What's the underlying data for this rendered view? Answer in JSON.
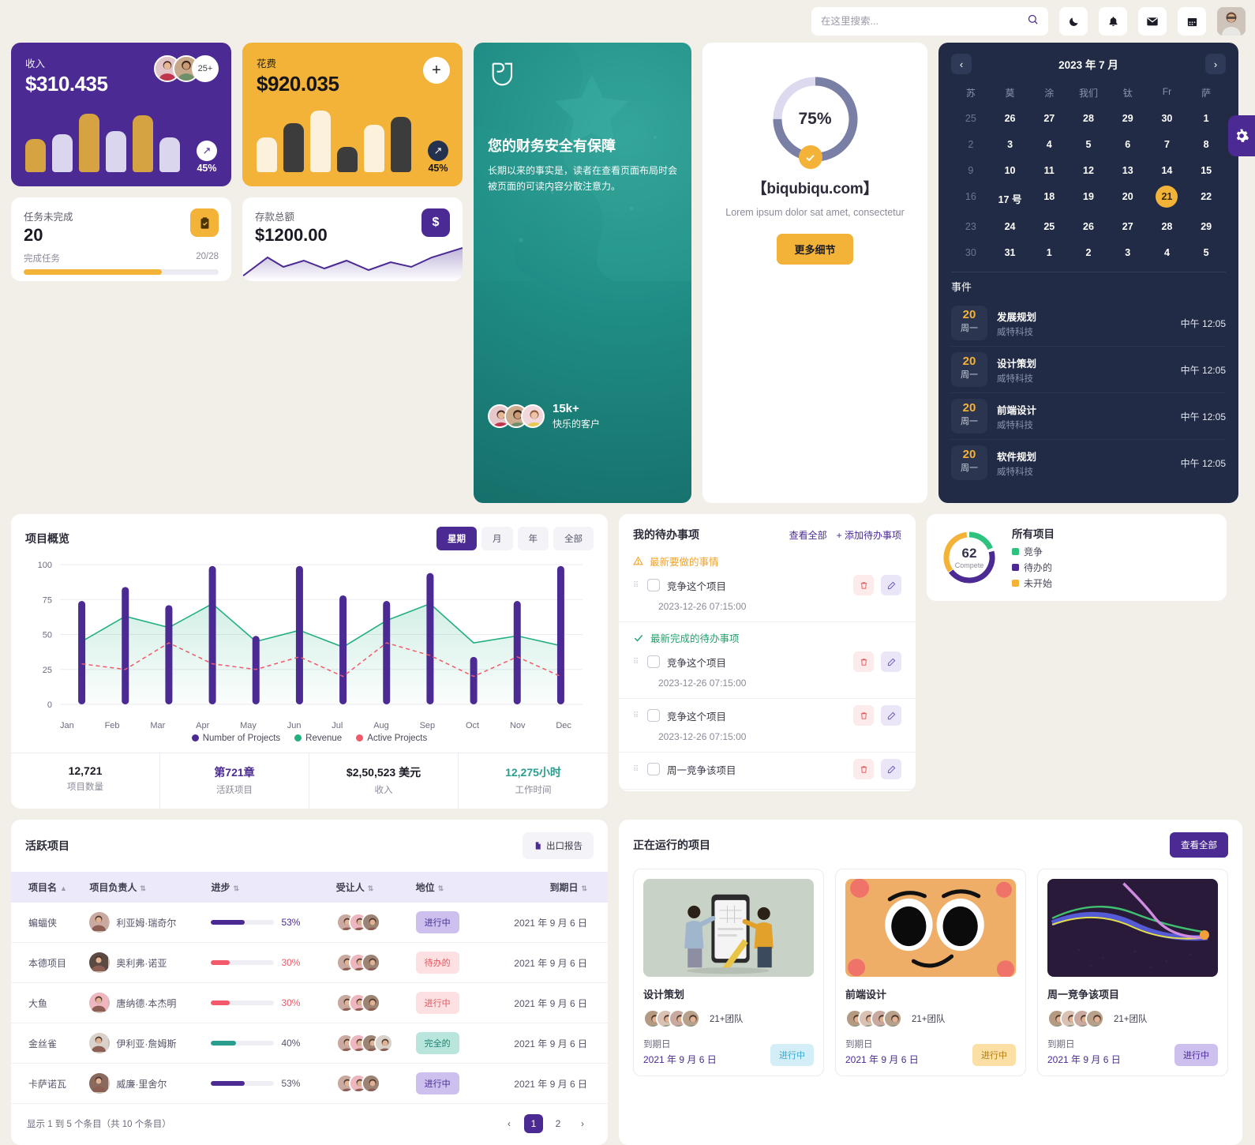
{
  "header": {
    "search_placeholder": "在这里搜索...",
    "icons": [
      "moon-icon",
      "bell-icon",
      "mail-icon",
      "calendar-icon"
    ]
  },
  "income_card": {
    "label": "收入",
    "value": "$310.435",
    "more": "25+",
    "pct": "45%"
  },
  "expense_card": {
    "label": "花费",
    "value": "$920.035",
    "pct": "45%"
  },
  "tasks_card": {
    "label": "任务未完成",
    "value": "20",
    "sub": "完成任务",
    "ratio": "20/28",
    "progress": 71
  },
  "savings_card": {
    "label": "存款总额",
    "value": "$1200.00",
    "currency": "$"
  },
  "promo": {
    "title": "您的财务安全有保障",
    "body": "长期以来的事实是，读者在查看页面布局时会被页面的可读内容分散注意力。",
    "count": "15k+",
    "count_label": "快乐的客户"
  },
  "progress_card": {
    "percent": "75%",
    "site": "【biqubiqu.com】",
    "lorem": "Lorem ipsum dolor sat amet, consectetur",
    "button": "更多细节"
  },
  "calendar": {
    "title": "2023 年 7 月",
    "prev": "‹",
    "next": "›",
    "dow": [
      "苏",
      "莫",
      "涂",
      "我们",
      "钛",
      "Fr",
      "萨"
    ],
    "weeks": [
      [
        {
          "d": "25",
          "m": 1
        },
        {
          "d": "26"
        },
        {
          "d": "27"
        },
        {
          "d": "28"
        },
        {
          "d": "29"
        },
        {
          "d": "30"
        },
        {
          "d": "1"
        }
      ],
      [
        {
          "d": "2",
          "m": 1
        },
        {
          "d": "3"
        },
        {
          "d": "4"
        },
        {
          "d": "5"
        },
        {
          "d": "6"
        },
        {
          "d": "7"
        },
        {
          "d": "8"
        }
      ],
      [
        {
          "d": "9",
          "m": 1
        },
        {
          "d": "10"
        },
        {
          "d": "11"
        },
        {
          "d": "12"
        },
        {
          "d": "13"
        },
        {
          "d": "14"
        },
        {
          "d": "15"
        }
      ],
      [
        {
          "d": "16",
          "m": 1
        },
        {
          "d": "17 号"
        },
        {
          "d": "18"
        },
        {
          "d": "19"
        },
        {
          "d": "20"
        },
        {
          "d": "21",
          "sel": 1
        },
        {
          "d": "22"
        }
      ],
      [
        {
          "d": "23",
          "m": 1
        },
        {
          "d": "24"
        },
        {
          "d": "25"
        },
        {
          "d": "26"
        },
        {
          "d": "27"
        },
        {
          "d": "28"
        },
        {
          "d": "29"
        }
      ],
      [
        {
          "d": "30",
          "m": 1
        },
        {
          "d": "31"
        },
        {
          "d": "1"
        },
        {
          "d": "2"
        },
        {
          "d": "3"
        },
        {
          "d": "4"
        },
        {
          "d": "5"
        }
      ]
    ],
    "events_title": "事件",
    "events": [
      {
        "day": "20",
        "weekday": "周一",
        "name": "发展规划",
        "org": "威特科技",
        "time": "中午 12:05"
      },
      {
        "day": "20",
        "weekday": "周一",
        "name": "设计策划",
        "org": "威特科技",
        "time": "中午 12:05"
      },
      {
        "day": "20",
        "weekday": "周一",
        "name": "前端设计",
        "org": "威特科技",
        "time": "中午 12:05"
      },
      {
        "day": "20",
        "weekday": "周一",
        "name": "软件规划",
        "org": "威特科技",
        "time": "中午 12:05"
      }
    ]
  },
  "overview": {
    "title": "项目概览",
    "tabs": [
      {
        "label": "星期",
        "active": true
      },
      {
        "label": "月",
        "active": false
      },
      {
        "label": "年",
        "active": false
      },
      {
        "label": "全部",
        "active": false
      }
    ],
    "stats": [
      {
        "n": "12,721",
        "l": "项目数量",
        "c": "#1a1a24"
      },
      {
        "n": "第721章",
        "l": "活跃项目",
        "c": "#4b2a94"
      },
      {
        "n": "$2,50,523 美元",
        "l": "收入",
        "c": "#1a1a24"
      },
      {
        "n": "12,275小时",
        "l": "工作时间",
        "c": "#2a9d8f"
      }
    ]
  },
  "chart_data": {
    "type": "bar",
    "title": "项目概览",
    "categories": [
      "Jan",
      "Feb",
      "Mar",
      "Apr",
      "May",
      "Jun",
      "Jul",
      "Aug",
      "Sep",
      "Oct",
      "Nov",
      "Dec"
    ],
    "series": [
      {
        "name": "Number of Projects",
        "type": "bar",
        "color": "#4b2a94",
        "values": [
          74,
          84,
          71,
          99,
          49,
          99,
          78,
          74,
          94,
          34,
          74,
          99
        ]
      },
      {
        "name": "Revenue",
        "type": "area",
        "color": "#22b07d",
        "values": [
          45,
          63,
          55,
          72,
          45,
          53,
          41,
          60,
          72,
          44,
          49,
          42
        ]
      },
      {
        "name": "Active Projects",
        "type": "line-dashed",
        "color": "#f2596a",
        "values": [
          29,
          25,
          44,
          29,
          25,
          34,
          20,
          44,
          35,
          20,
          34,
          20
        ]
      }
    ],
    "ylim": [
      0,
      100
    ],
    "yticks": [
      0,
      25,
      50,
      75,
      100
    ],
    "xlabel": "",
    "ylabel": "",
    "grid": true,
    "legend_position": "bottom"
  },
  "todo": {
    "title": "我的待办事项",
    "view_all": "查看全部",
    "add": "+ 添加待办事项",
    "group_pending": "最新要做的事情",
    "group_done": "最新完成的待办事项",
    "items": [
      {
        "name": "竞争这个项目",
        "date": "2023-12-26 07:15:00"
      },
      {
        "name": "竞争这个项目",
        "date": "2023-12-26 07:15:00"
      },
      {
        "name": "竞争这个项目",
        "date": "2023-12-26 07:15:00"
      },
      {
        "name": "周一竞争该项目",
        "date": ""
      }
    ]
  },
  "all_projects": {
    "total": "62",
    "total_label": "Compete",
    "title": "所有项目",
    "legend": [
      {
        "label": "竞争",
        "color": "#2ec27e"
      },
      {
        "label": "待办的",
        "color": "#4b2a94"
      },
      {
        "label": "未开始",
        "color": "#f2b338"
      }
    ]
  },
  "active_table": {
    "title": "活跃项目",
    "export": "出口报告",
    "columns": [
      "项目名",
      "项目负责人",
      "进步",
      "受让人",
      "地位",
      "到期日"
    ],
    "rows": [
      {
        "name": "蝙蝠侠",
        "owner": "利亚姆·瑞奇尔",
        "progress": 53,
        "progress_text": "53%",
        "bar_color": "#4b2a94",
        "text_color": "#4b2a94",
        "status": "进行中",
        "status_bg": "#cdc0ef",
        "status_fg": "#4b2a94",
        "due": "2021 年 9 月 6 日",
        "avatars": 3,
        "owner_av": "#c9a9a0"
      },
      {
        "name": "本德项目",
        "owner": "奥利弗·诺亚",
        "progress": 30,
        "progress_text": "30%",
        "bar_color": "#f2596a",
        "text_color": "#f2596a",
        "status": "待办的",
        "status_bg": "#fde0e1",
        "status_fg": "#e2565f",
        "due": "2021 年 9 月 6 日",
        "avatars": 3,
        "owner_av": "#5a4a42"
      },
      {
        "name": "大鱼",
        "owner": "唐纳德·本杰明",
        "progress": 30,
        "progress_text": "30%",
        "bar_color": "#f2596a",
        "text_color": "#f2596a",
        "status": "进行中",
        "status_bg": "#fde0e1",
        "status_fg": "#e2565f",
        "due": "2021 年 9 月 6 日",
        "avatars": 3,
        "owner_av": "#eeb6bf"
      },
      {
        "name": "金丝雀",
        "owner": "伊利亚·詹姆斯",
        "progress": 40,
        "progress_text": "40%",
        "bar_color": "#2a9d8f",
        "text_color": "#55556a",
        "status": "完全的",
        "status_bg": "#b8e6dc",
        "status_fg": "#1e7f72",
        "due": "2021 年 9 月 6 日",
        "avatars": 4,
        "owner_av": "#d9d2cb"
      },
      {
        "name": "卡萨诺瓦",
        "owner": "威廉·里舍尔",
        "progress": 53,
        "progress_text": "53%",
        "bar_color": "#4b2a94",
        "text_color": "#55556a",
        "status": "进行中",
        "status_bg": "#cdc0ef",
        "status_fg": "#4b2a94",
        "due": "2021 年 9 月 6 日",
        "avatars": 3,
        "owner_av": "#8a6a5c"
      }
    ],
    "footer": "显示 1 到 5 个条目（共 10 个条目）",
    "pages": [
      "1",
      "2"
    ]
  },
  "running": {
    "title": "正在运行的项目",
    "view_all": "查看全部",
    "due_label": "到期日",
    "cards": [
      {
        "name": "设计策划",
        "team": "21+团队",
        "due": "2021 年 9 月 6 日",
        "status": "进行中",
        "status_bg": "#d4eef7",
        "status_fg": "#3aa7c9",
        "thumb": "design-illustration"
      },
      {
        "name": "前端设计",
        "team": "21+团队",
        "due": "2021 年 9 月 6 日",
        "status": "进行中",
        "status_bg": "#fbdfa4",
        "status_fg": "#b07c10",
        "thumb": "face-illustration"
      },
      {
        "name": "周一竞争该项目",
        "team": "21+团队",
        "due": "2021 年 9 月 6 日",
        "status": "进行中",
        "status_bg": "#cdc0ef",
        "status_fg": "#4b2a94",
        "thumb": "wave-illustration"
      }
    ]
  }
}
